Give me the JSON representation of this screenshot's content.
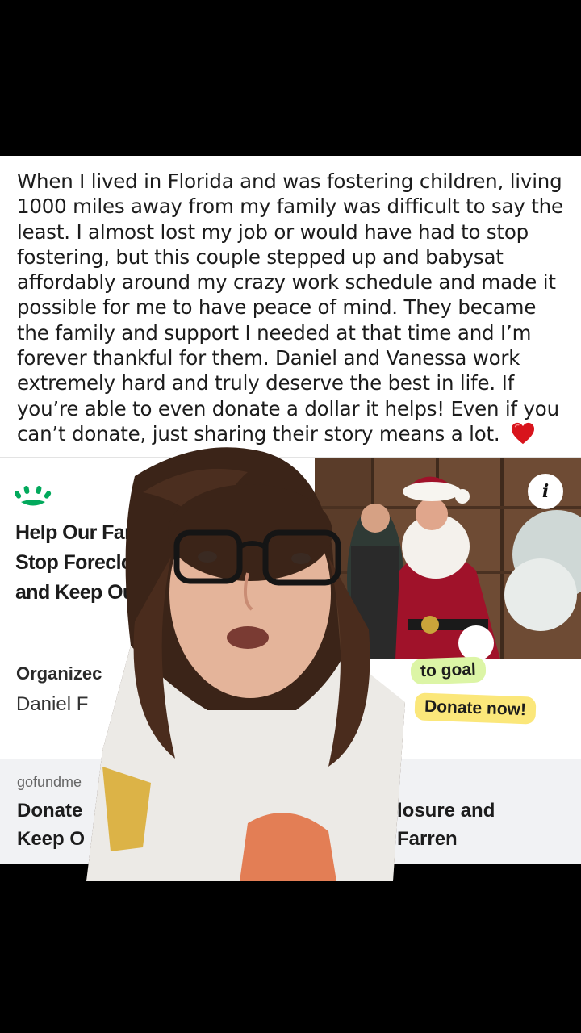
{
  "post": {
    "text": "When I lived in Florida and was fostering children, living 1000 miles away from my family was difficult to say the least. I almost lost my job or would have had to stop fostering, but this couple stepped up and babysat affordably around my crazy work schedule and made it possible for me to have peace of mind. They became the family and support I needed at that time and I’m forever thankful for them. Daniel and Vanessa work extremely hard and truly deserve the best in life. If you’re able to even donate a dollar it helps! Even if you can’t donate, just sharing their story means a lot.",
    "emoji": "red-heart-icon"
  },
  "card": {
    "logo_icon": "gofundme-logo-icon",
    "title_lines": [
      "Help Our Fami",
      "Stop Foreclos",
      "and Keep Ou"
    ],
    "info_label": "i",
    "organizer_label": "Organizec",
    "organizer_name": "Daniel F",
    "goal_text": "to goal",
    "donate_button": "Donate now!"
  },
  "link_preview": {
    "domain": "gofundme",
    "title_left_1": "Donate",
    "title_left_2": "Keep O",
    "title_right_1": "losure and",
    "title_right_2": "Farren"
  },
  "colors": {
    "brand_green": "#02a95c",
    "goal_pill": "#dcf5a6",
    "donate_pill": "#fbe77a",
    "heart": "#d8141c"
  }
}
